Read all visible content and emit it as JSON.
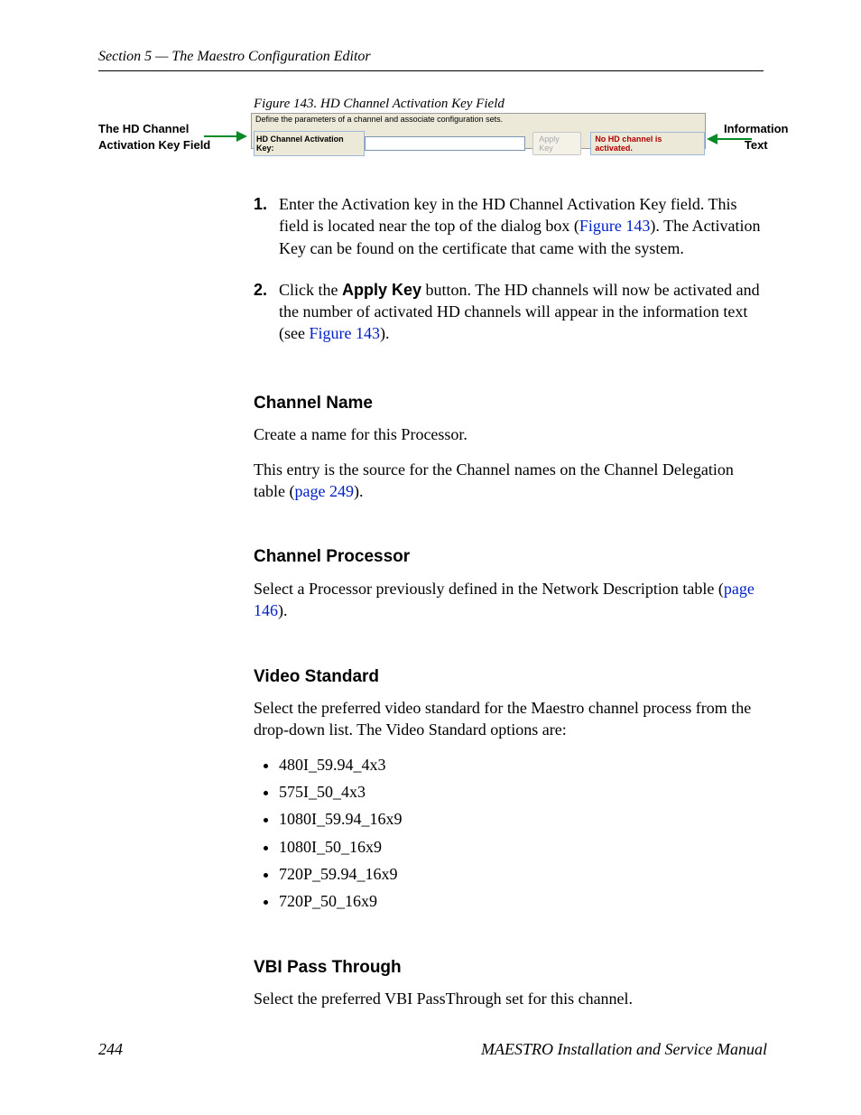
{
  "header": "Section 5 — The Maestro Configuration Editor",
  "figure": {
    "caption": "Figure 143.  HD Channel Activation Key Field",
    "left_label_l1": "The HD Channel",
    "left_label_l2": "Activation Key Field",
    "right_label_l1": "Information",
    "right_label_l2": "Text",
    "panel_desc": "Define the parameters of a channel and associate configuration sets.",
    "panel_key_label": "HD Channel Activation Key:",
    "panel_apply": "Apply Key",
    "panel_status": "No HD channel is activated."
  },
  "steps": [
    {
      "num": "1.",
      "pre": "Enter the Activation key in the HD Channel Activation Key field. This field is located near the top of the dialog box (",
      "link": "Figure 143",
      "post": "). The Activation Key can be found on the certificate that came with the system."
    },
    {
      "num": "2.",
      "pre": "Click the ",
      "bold": "Apply Key",
      "mid": " button. The HD channels will now be activated and the number of activated HD channels will appear in the information text (see ",
      "link": "Figure 143",
      "post": ")."
    }
  ],
  "sections": {
    "channel_name": {
      "heading": "Channel Name",
      "p1": "Create a name for this Processor.",
      "p2_pre": "This entry is the source for the Channel names on the Channel Delegation table (",
      "p2_link": "page 249",
      "p2_post": ")."
    },
    "channel_processor": {
      "heading": "Channel Processor",
      "p1_pre": "Select a Processor previously defined in the Network Description table (",
      "p1_link": "page 146",
      "p1_post": ")."
    },
    "video_standard": {
      "heading": "Video Standard",
      "p1": "Select the preferred video standard for the Maestro channel process from the drop-down list. The Video Standard options are:",
      "items": [
        "480I_59.94_4x3",
        "575I_50_4x3",
        "1080I_59.94_16x9",
        "1080I_50_16x9",
        "720P_59.94_16x9",
        "720P_50_16x9"
      ]
    },
    "vbi": {
      "heading": "VBI Pass Through",
      "p1": "Select the preferred VBI PassThrough set for this channel."
    }
  },
  "footer": {
    "page": "244",
    "title": "MAESTRO Installation and Service Manual"
  }
}
